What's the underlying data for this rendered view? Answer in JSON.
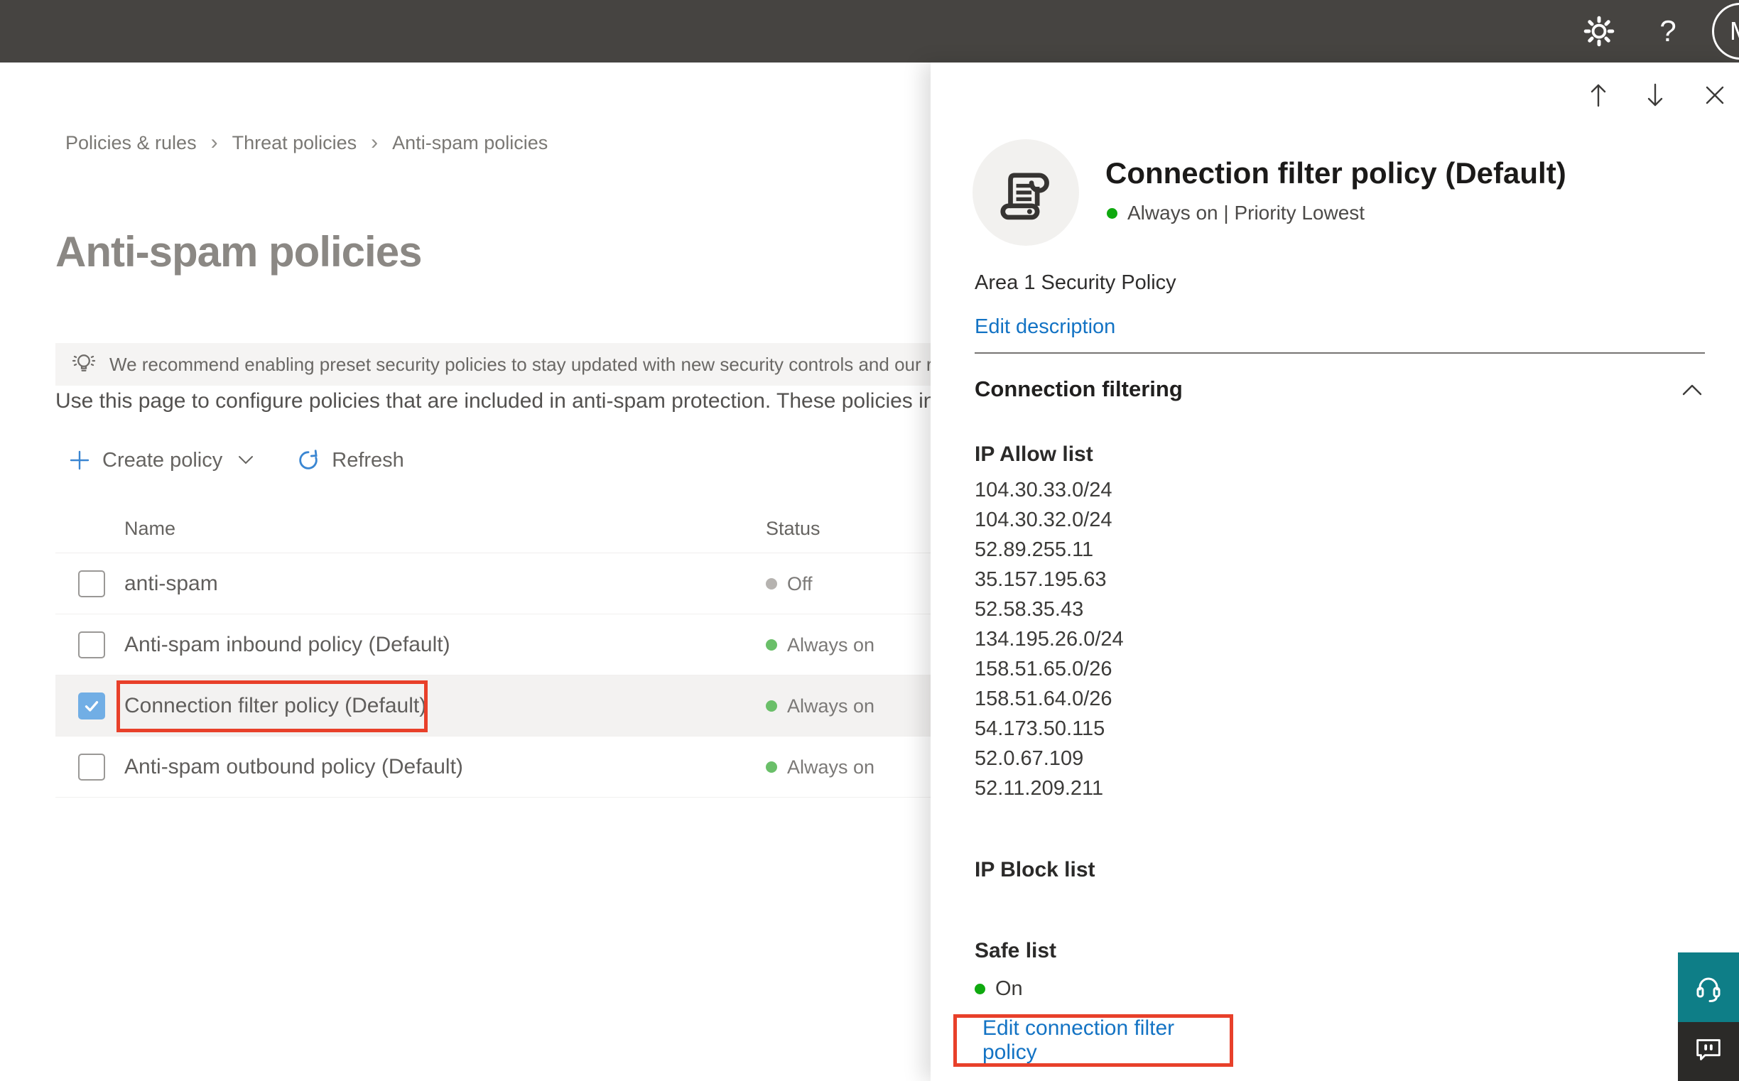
{
  "topbar": {
    "avatar_initial": "M"
  },
  "breadcrumb": {
    "separator": "›",
    "items": [
      "Policies & rules",
      "Threat policies",
      "Anti-spam policies"
    ]
  },
  "page": {
    "title": "Anti-spam policies",
    "banner_text": "We recommend enabling preset security policies to stay updated with new security controls and our recomme",
    "description": "Use this page to configure policies that are included in anti-spam protection. These policies include"
  },
  "toolbar": {
    "create_policy_label": "Create policy",
    "refresh_label": "Refresh"
  },
  "table": {
    "columns": [
      "Name",
      "Status"
    ],
    "rows": [
      {
        "name": "anti-spam",
        "status": "Off",
        "checked": false,
        "selected": false
      },
      {
        "name": "Anti-spam inbound policy (Default)",
        "status": "Always on",
        "checked": false,
        "selected": false
      },
      {
        "name": "Connection filter policy (Default)",
        "status": "Always on",
        "checked": true,
        "selected": true
      },
      {
        "name": "Anti-spam outbound policy (Default)",
        "status": "Always on",
        "checked": false,
        "selected": false
      }
    ]
  },
  "flyout": {
    "title": "Connection filter policy (Default)",
    "status_line": "Always on | Priority Lowest",
    "description": "Area 1 Security Policy",
    "edit_description_label": "Edit description",
    "section_title": "Connection filtering",
    "ip_allow_title": "IP Allow list",
    "ip_allow": [
      "104.30.33.0/24",
      "104.30.32.0/24",
      "52.89.255.11",
      "35.157.195.63",
      "52.58.35.43",
      "134.195.26.0/24",
      "158.51.65.0/26",
      "158.51.64.0/26",
      "54.173.50.115",
      "52.0.67.109",
      "52.11.209.211"
    ],
    "ip_block_title": "IP Block list",
    "safe_list_title": "Safe list",
    "safe_list_status": "On",
    "edit_link_label": "Edit connection filter policy"
  },
  "colors": {
    "topbar_bg": "#464441",
    "link_blue": "#1373c4",
    "status_on_green": "#6abf69",
    "status_bright_green": "#0fa90f",
    "status_off_gray": "#b6b3b0",
    "annotation_red": "#e8402a",
    "selected_row_bg": "#f3f2f1",
    "checkbox_checked_blue": "#71aee5",
    "help_widget_teal": "#0e7e87",
    "feedback_widget_dark": "#2b2a28"
  }
}
